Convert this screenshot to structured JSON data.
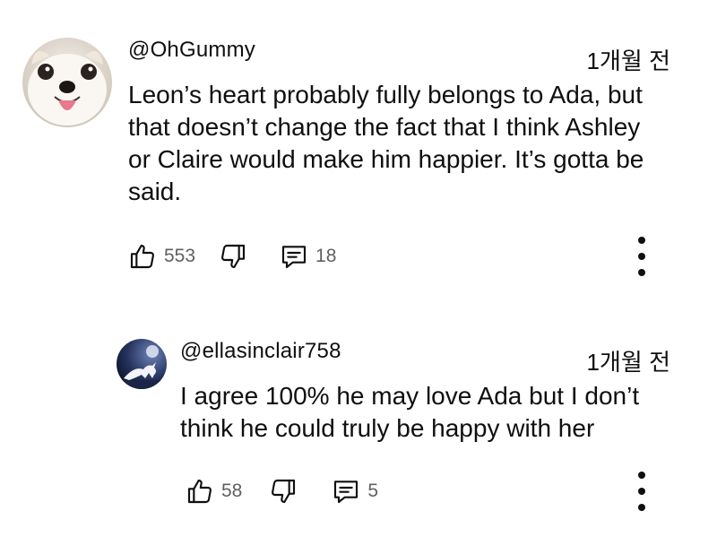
{
  "comments": [
    {
      "author": "@OhGummy",
      "time": "1개월 전",
      "text": "Leon’s heart probably fully belongs to Ada, but\nthat doesn’t change the fact that I think Ashley\nor Claire would make him happier. It’s gotta be\nsaid.",
      "likes": "553",
      "replies": "18",
      "avatar": "dog-avatar"
    },
    {
      "author": "@ellasinclair758",
      "time": "1개월 전",
      "text": "I agree 100% he may love Ada but I don’t\nthink he could truly be happy with her",
      "likes": "58",
      "replies": "5",
      "avatar": "unicorn-avatar"
    }
  ],
  "colors": {
    "text": "#0f0f0f",
    "secondary": "#606060"
  }
}
